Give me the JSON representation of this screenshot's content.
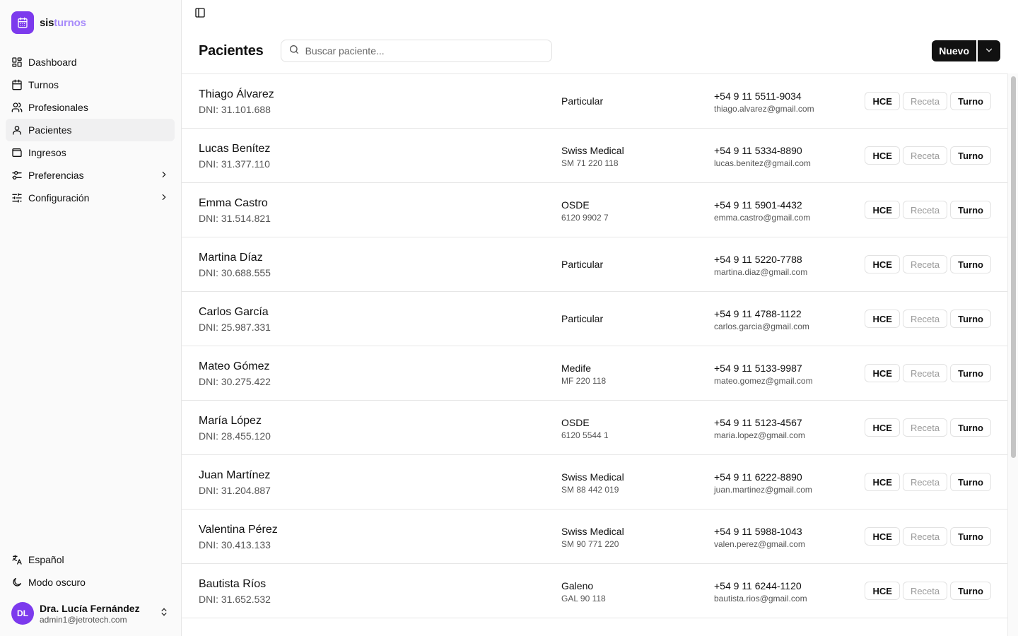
{
  "brand": {
    "part1": "sis",
    "part2": "turnos"
  },
  "nav": [
    {
      "label": "Dashboard",
      "icon": "dashboard-icon"
    },
    {
      "label": "Turnos",
      "icon": "calendar-icon"
    },
    {
      "label": "Profesionales",
      "icon": "users-icon"
    },
    {
      "label": "Pacientes",
      "icon": "user-icon",
      "active": true
    },
    {
      "label": "Ingresos",
      "icon": "wallet-icon"
    },
    {
      "label": "Preferencias",
      "icon": "sliders-icon",
      "expandable": true
    },
    {
      "label": "Configuración",
      "icon": "settings-sliders-icon",
      "expandable": true
    }
  ],
  "bottom": {
    "language": "Español",
    "dark_mode": "Modo oscuro",
    "user": {
      "initials": "DL",
      "name": "Dra. Lucía Fernández",
      "email": "admin1@jetrotech.com"
    }
  },
  "header": {
    "title": "Pacientes",
    "search_placeholder": "Buscar paciente...",
    "new_label": "Nuevo"
  },
  "row_actions": {
    "hce": "HCE",
    "receta": "Receta",
    "turno": "Turno"
  },
  "patients": [
    {
      "name": "Thiago Álvarez",
      "dni": "DNI: 31.101.688",
      "insurance": "Particular",
      "insurance_number": "",
      "phone": "+54 9 11 5511-9034",
      "email": "thiago.alvarez@gmail.com"
    },
    {
      "name": "Lucas Benítez",
      "dni": "DNI: 31.377.110",
      "insurance": "Swiss Medical",
      "insurance_number": "SM 71 220 118",
      "phone": "+54 9 11 5334-8890",
      "email": "lucas.benitez@gmail.com"
    },
    {
      "name": "Emma Castro",
      "dni": "DNI: 31.514.821",
      "insurance": "OSDE",
      "insurance_number": "6120 9902 7",
      "phone": "+54 9 11 5901-4432",
      "email": "emma.castro@gmail.com"
    },
    {
      "name": "Martina Díaz",
      "dni": "DNI: 30.688.555",
      "insurance": "Particular",
      "insurance_number": "",
      "phone": "+54 9 11 5220-7788",
      "email": "martina.diaz@gmail.com"
    },
    {
      "name": "Carlos García",
      "dni": "DNI: 25.987.331",
      "insurance": "Particular",
      "insurance_number": "",
      "phone": "+54 9 11 4788-1122",
      "email": "carlos.garcia@gmail.com"
    },
    {
      "name": "Mateo Gómez",
      "dni": "DNI: 30.275.422",
      "insurance": "Medife",
      "insurance_number": "MF 220 118",
      "phone": "+54 9 11 5133-9987",
      "email": "mateo.gomez@gmail.com"
    },
    {
      "name": "María López",
      "dni": "DNI: 28.455.120",
      "insurance": "OSDE",
      "insurance_number": "6120 5544 1",
      "phone": "+54 9 11 5123-4567",
      "email": "maria.lopez@gmail.com"
    },
    {
      "name": "Juan Martínez",
      "dni": "DNI: 31.204.887",
      "insurance": "Swiss Medical",
      "insurance_number": "SM 88 442 019",
      "phone": "+54 9 11 6222-8890",
      "email": "juan.martinez@gmail.com"
    },
    {
      "name": "Valentina Pérez",
      "dni": "DNI: 30.413.133",
      "insurance": "Swiss Medical",
      "insurance_number": "SM 90 771 220",
      "phone": "+54 9 11 5988-1043",
      "email": "valen.perez@gmail.com"
    },
    {
      "name": "Bautista Ríos",
      "dni": "DNI: 31.652.532",
      "insurance": "Galeno",
      "insurance_number": "GAL 90 118",
      "phone": "+54 9 11 6244-1120",
      "email": "bautista.rios@gmail.com"
    }
  ],
  "colors": {
    "brand": "#7c3aed",
    "brand_light": "#a78bfa",
    "primary_button": "#111111"
  }
}
